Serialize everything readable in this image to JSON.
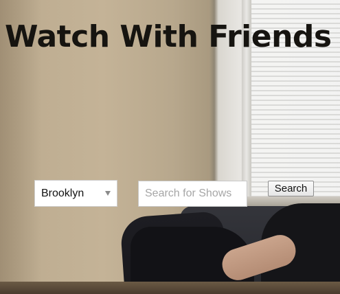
{
  "header": {
    "title": "Watch With Friends"
  },
  "search": {
    "location": {
      "selected": "Brooklyn"
    },
    "query": {
      "value": "",
      "placeholder": "Search for Shows"
    },
    "button_label": "Search"
  },
  "colors": {
    "title_text": "#161410",
    "input_background": "#ffffff",
    "placeholder_text": "#a6a6a6"
  },
  "icons": {
    "location_dropdown": "chevron-down-icon"
  }
}
